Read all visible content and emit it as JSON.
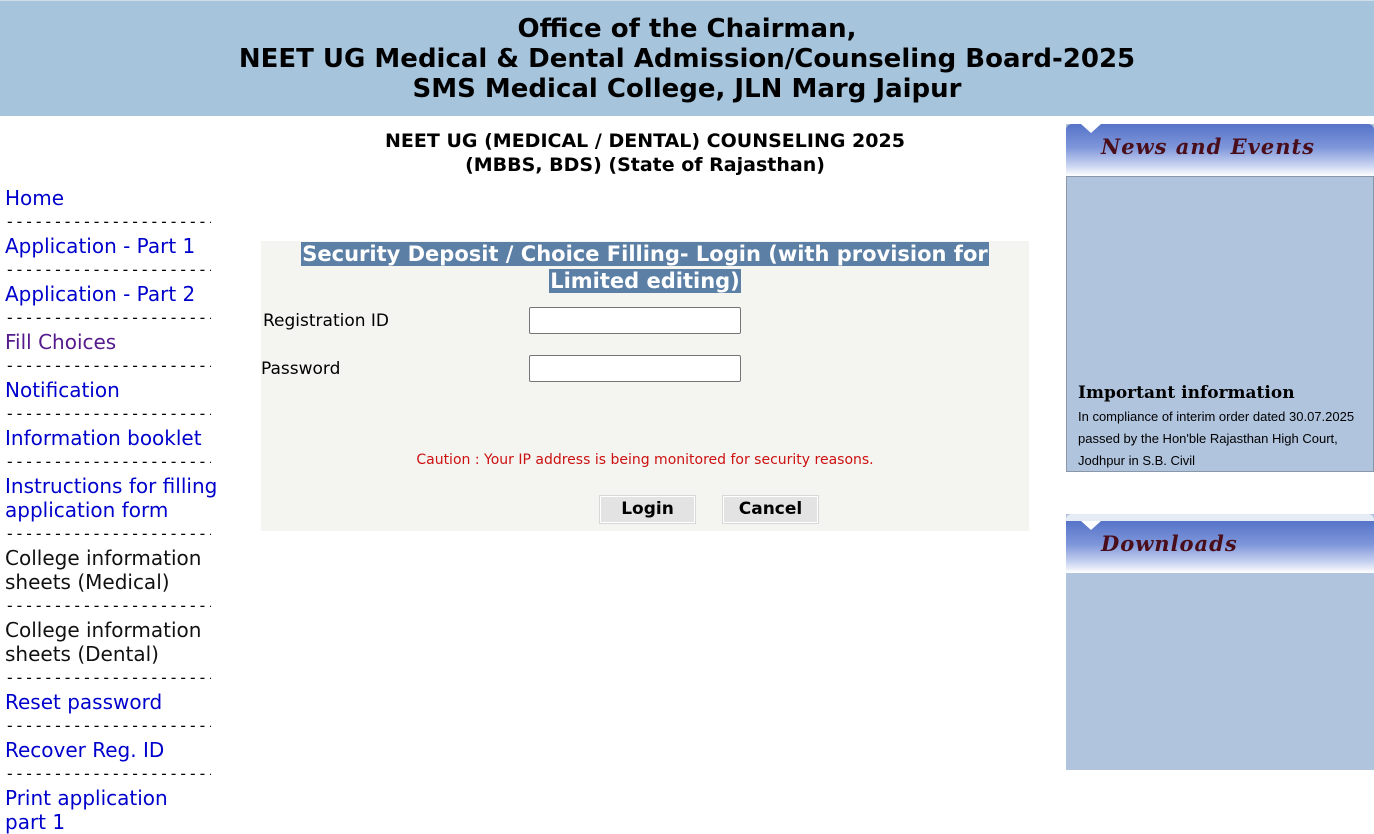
{
  "header": {
    "line1": "Office of the Chairman,",
    "line2": "NEET UG Medical & Dental Admission/Counseling Board-2025",
    "line3": "SMS Medical College, JLN Marg Jaipur"
  },
  "sidebar": {
    "separator": "-----------------------",
    "items": [
      {
        "label": "Home"
      },
      {
        "label": "Application - Part 1"
      },
      {
        "label": "Application - Part 2"
      },
      {
        "label": "Fill Choices"
      },
      {
        "label": "Notification"
      },
      {
        "label": "Information booklet"
      },
      {
        "label": "Instructions for filling application form"
      },
      {
        "label": "College information sheets (Medical)"
      },
      {
        "label": "College information sheets (Dental)"
      },
      {
        "label": "Reset password"
      },
      {
        "label": "Recover Reg. ID"
      },
      {
        "label": "Print application part 1"
      }
    ]
  },
  "main": {
    "title_line1": "NEET UG (MEDICAL / DENTAL) COUNSELING 2025",
    "title_line2": "(MBBS, BDS) (State of Rajasthan)"
  },
  "login": {
    "heading_line1": "Security Deposit / Choice Filling- Login (with provision for",
    "heading_line2": "Limited editing)",
    "registration_label": "Registration ID",
    "registration_value": "",
    "password_label": "Password",
    "password_value": "",
    "caution": "Caution : Your IP address is being monitored for security reasons.",
    "login_label": "Login",
    "cancel_label": "Cancel"
  },
  "news": {
    "title": "News and Events",
    "important_title": "Important information",
    "important_text": "In compliance of interim order dated 30.07.2025 passed by the Hon'ble Rajasthan High Court, Jodhpur in S.B. Civil"
  },
  "downloads": {
    "title": "Downloads"
  },
  "colors": {
    "header_bg": "#a6c4dc",
    "link": "#0000cc",
    "visited_link": "#551a8b",
    "login_heading_bg": "#5c7fa6",
    "caution": "#cc1111",
    "panel_bg": "#b0c4de",
    "panel_title": "#4a0e1a"
  }
}
